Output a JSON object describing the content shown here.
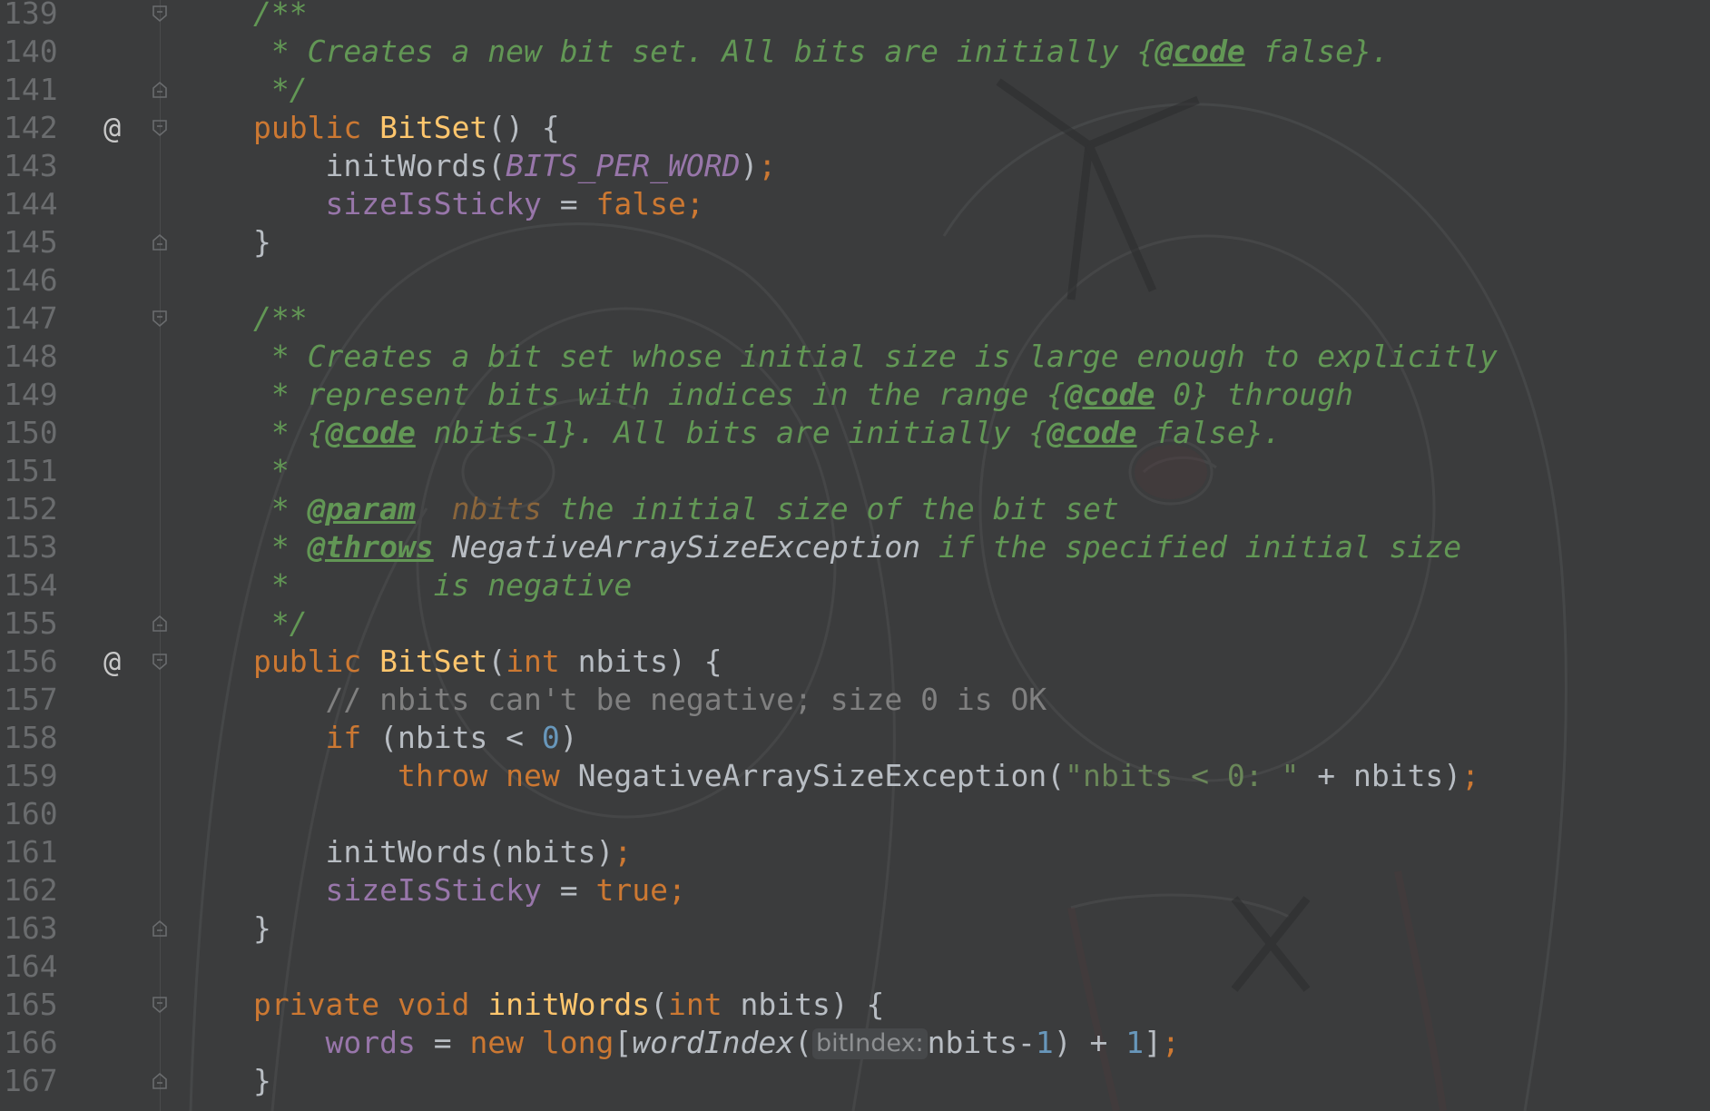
{
  "editor": {
    "language": "Java",
    "colors": {
      "background": "#3b3c3d",
      "keyword": "#cc7832",
      "method": "#ffc66d",
      "field": "#9876aa",
      "number": "#6897bb",
      "string": "#6a8759",
      "doc_comment": "#629755",
      "line_comment": "#808080"
    },
    "lines": [
      {
        "num": "139",
        "fold": "open"
      },
      {
        "num": "140"
      },
      {
        "num": "141",
        "fold": "close"
      },
      {
        "num": "142",
        "annotation": "@",
        "fold": "open"
      },
      {
        "num": "143"
      },
      {
        "num": "144"
      },
      {
        "num": "145",
        "fold": "close"
      },
      {
        "num": "146"
      },
      {
        "num": "147",
        "fold": "open"
      },
      {
        "num": "148"
      },
      {
        "num": "149"
      },
      {
        "num": "150"
      },
      {
        "num": "151"
      },
      {
        "num": "152"
      },
      {
        "num": "153"
      },
      {
        "num": "154"
      },
      {
        "num": "155",
        "fold": "close"
      },
      {
        "num": "156",
        "annotation": "@",
        "fold": "open"
      },
      {
        "num": "157"
      },
      {
        "num": "158"
      },
      {
        "num": "159"
      },
      {
        "num": "160"
      },
      {
        "num": "161"
      },
      {
        "num": "162"
      },
      {
        "num": "163",
        "fold": "close"
      },
      {
        "num": "164"
      },
      {
        "num": "165",
        "fold": "open"
      },
      {
        "num": "166"
      },
      {
        "num": "167",
        "fold": "close"
      }
    ],
    "code": {
      "l139": {
        "t0": "/**"
      },
      "l140": {
        "t0": " * Creates a new bit set. All bits are initially {",
        "t1": "@code",
        "t2": " false}."
      },
      "l141": {
        "t0": " */"
      },
      "l142": {
        "t0": "public",
        "t1": " ",
        "t2": "BitSet",
        "t3": "() {"
      },
      "l143": {
        "t0": "    initWords(",
        "t1": "BITS_PER_WORD",
        "t2": ")",
        "t3": ";"
      },
      "l144": {
        "t0": "    ",
        "t1": "sizeIsSticky",
        "t2": " = ",
        "t3": "false",
        "t4": ";"
      },
      "l145": {
        "t0": "}"
      },
      "l147": {
        "t0": "/**"
      },
      "l148": {
        "t0": " * Creates a bit set whose initial size is large enough to explicitly"
      },
      "l149": {
        "t0": " * represent bits with indices in the range {",
        "t1": "@code",
        "t2": " 0} through"
      },
      "l150": {
        "t0": " * {",
        "t1": "@code",
        "t2": " nbits-1}. All bits are initially {",
        "t3": "@code",
        "t4": " false}."
      },
      "l151": {
        "t0": " *"
      },
      "l152": {
        "t0": " * ",
        "t1": "@param",
        "t2": "  ",
        "t3": "nbits",
        "t4": " the initial size of the bit set"
      },
      "l153": {
        "t0": " * ",
        "t1": "@throws",
        "t2": " ",
        "t3": "NegativeArraySizeException",
        "t4": " if the specified initial size"
      },
      "l154": {
        "t0": " *        is negative"
      },
      "l155": {
        "t0": " */"
      },
      "l156": {
        "t0": "public",
        "t1": " ",
        "t2": "BitSet",
        "t3": "(",
        "t4": "int",
        "t5": " nbits) {"
      },
      "l157": {
        "t0": "    // nbits can't be negative; size 0 is OK"
      },
      "l158": {
        "t0": "    ",
        "t1": "if",
        "t2": " (nbits < ",
        "t3": "0",
        "t4": ")"
      },
      "l159": {
        "t0": "        ",
        "t1": "throw",
        "t2": " ",
        "t3": "new",
        "t4": " NegativeArraySizeException(",
        "t5": "\"nbits < 0: \"",
        "t6": " + nbits)",
        "t7": ";"
      },
      "l161": {
        "t0": "    initWords(nbits)",
        "t1": ";"
      },
      "l162": {
        "t0": "    ",
        "t1": "sizeIsSticky",
        "t2": " = ",
        "t3": "true",
        "t4": ";"
      },
      "l163": {
        "t0": "}"
      },
      "l165": {
        "t0": "private",
        "t1": " ",
        "t2": "void",
        "t3": " ",
        "t4": "initWords",
        "t5": "(",
        "t6": "int",
        "t7": " nbits) {"
      },
      "l166": {
        "t0": "    ",
        "t1": "words",
        "t2": " = ",
        "t3": "new",
        "t4": " ",
        "t5": "long",
        "t6": "[",
        "t7": "wordIndex",
        "t8": "(",
        "hint": "bitIndex:",
        "t9": "nbits-",
        "t10": "1",
        "t11": ") + ",
        "t12": "1",
        "t13": "]",
        "t14": ";"
      },
      "l167": {
        "t0": "}"
      }
    }
  }
}
